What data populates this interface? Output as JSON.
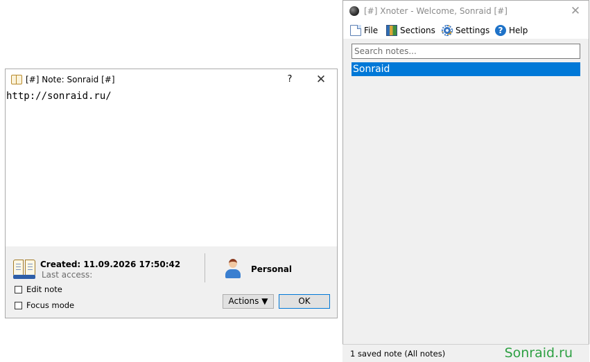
{
  "main_window": {
    "title": "[#] Xnoter - Welcome, Sonraid [#]",
    "close_glyph": "✕",
    "menu": [
      {
        "label": "File",
        "icon": "file-icon"
      },
      {
        "label": "Sections",
        "icon": "sections-icon"
      },
      {
        "label": "Settings",
        "icon": "settings-icon"
      },
      {
        "label": "Help",
        "icon": "help-icon"
      }
    ],
    "search": {
      "placeholder": "Search notes...",
      "value": ""
    },
    "notes": [
      {
        "label": "Sonraid",
        "selected": true
      }
    ],
    "status": {
      "text": "1 saved note (All notes)",
      "brand": "Sonraid.ru"
    },
    "accent_color": "#0078d7",
    "brand_color": "#2ea043"
  },
  "note_window": {
    "title": "[#] Note: Sonraid [#]",
    "help_glyph": "?",
    "close_glyph": "✕",
    "content": "http://sonraid.ru/",
    "created": "Created: 11.09.2026 17:50:42",
    "last_access": "Last access:",
    "section": "Personal",
    "checkboxes": [
      {
        "label": "Edit note",
        "checked": false
      },
      {
        "label": "Focus mode",
        "checked": false
      }
    ],
    "actions_label": "Actions ▼",
    "ok_label": "OK"
  }
}
